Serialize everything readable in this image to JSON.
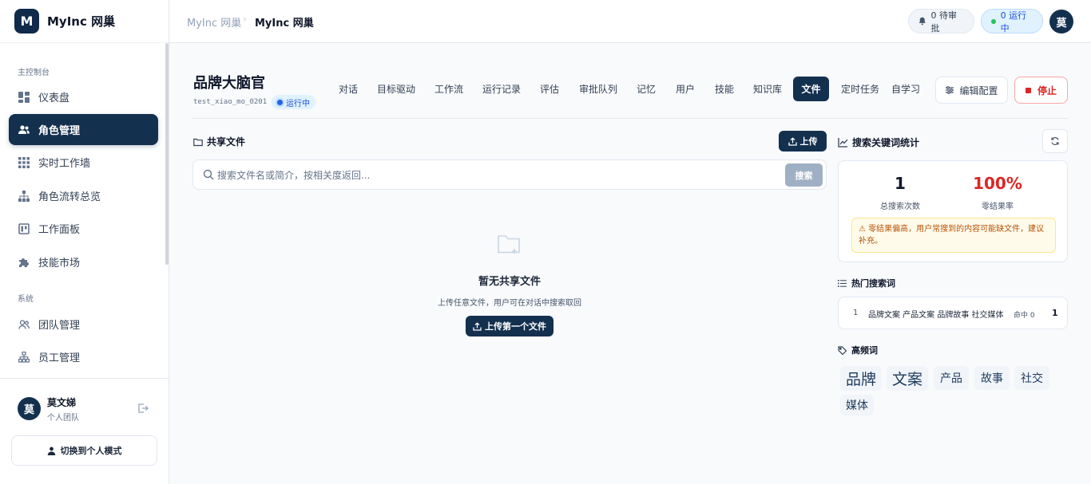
{
  "brand": {
    "logo_letter": "M",
    "name": "MyInc 网巢"
  },
  "sidebar": {
    "section_main": "主控制台",
    "section_system": "系统",
    "items": [
      {
        "label": "仪表盘",
        "icon": "dashboard-icon"
      },
      {
        "label": "角色管理",
        "icon": "users-icon",
        "active": true
      },
      {
        "label": "实时工作墙",
        "icon": "grid-icon"
      },
      {
        "label": "角色流转总览",
        "icon": "hierarchy-icon"
      },
      {
        "label": "工作面板",
        "icon": "board-icon"
      },
      {
        "label": "技能市场",
        "icon": "puzzle-icon"
      }
    ],
    "system_items": [
      {
        "label": "团队管理",
        "icon": "team-icon"
      },
      {
        "label": "员工管理",
        "icon": "org-icon"
      }
    ],
    "user": {
      "avatar": "莫",
      "name": "莫文娣",
      "team": "个人团队"
    },
    "switch_label": "切换到个人模式"
  },
  "header": {
    "breadcrumb_root": "MyInc 网巢",
    "breadcrumb_current": "MyInc 网巢",
    "approval_pill": "0 待审批",
    "running_pill": "0 运行中",
    "avatar": "莫"
  },
  "agent": {
    "title": "品牌大脑官",
    "id": "test_xiao_mo_0201",
    "status": "运行中",
    "tabs": [
      "对话",
      "目标驱动",
      "工作流",
      "运行记录",
      "评估",
      "审批队列",
      "记忆",
      "用户",
      "技能",
      "知识库",
      "文件",
      "定时任务",
      "自学习"
    ],
    "active_tab": "文件",
    "edit_config": "编辑配置",
    "stop": "停止"
  },
  "files": {
    "title": "共享文件",
    "upload": "上传",
    "search_placeholder": "搜索文件名或简介，按相关度返回...",
    "search_button": "搜索",
    "empty_title": "暂无共享文件",
    "empty_desc": "上传任意文件，用户可在对话中搜索取回",
    "first_upload": "上传第一个文件"
  },
  "stats": {
    "title": "搜索关键词统计",
    "total_value": "1",
    "total_label": "总搜索次数",
    "zero_value": "100%",
    "zero_label": "零结果率",
    "warning": "⚠ 零结果偏高，用户常搜到的内容可能缺文件，建议补充。",
    "hot_title": "热门搜索词",
    "hot_terms": [
      {
        "rank": "1",
        "term": "品牌文案 产品文案 品牌故事 社交媒体",
        "hits": "命中 0",
        "count": "1"
      }
    ],
    "freq_title": "高频词",
    "tags": [
      "品牌",
      "文案",
      "产品",
      "故事",
      "社交",
      "媒体"
    ]
  },
  "colors": {
    "primary": "#14304f",
    "danger": "#dc2626",
    "accent_red": "#dc2626"
  }
}
